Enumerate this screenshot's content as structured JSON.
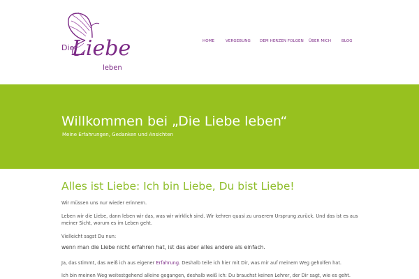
{
  "logo": {
    "word_die": "Die",
    "word_liebe": "Liebe",
    "word_leben": "leben",
    "icon": "butterfly-icon",
    "color": "#7c2a86"
  },
  "nav": {
    "items": [
      {
        "label": "HOME"
      },
      {
        "label": "VERGEBUNG"
      },
      {
        "label": "DEM HERZEN FOLGEN"
      },
      {
        "label": "ÜBER MICH"
      },
      {
        "label": "BLOG"
      }
    ],
    "color": "#7c2a86"
  },
  "hero": {
    "title": "Willkommen bei „Die Liebe leben“",
    "subtitle": "Meine Erfahrungen, Gedanken und Ansichten",
    "background": "#97c11f"
  },
  "content": {
    "title": "Alles ist Liebe: Ich bin Liebe, Du bist Liebe!",
    "p1": "Wir müssen uns nur wieder erinnern.",
    "p2": "Leben wir die Liebe, dann leben wir das, was wir wirklich sind. Wir kehren quasi zu unserem Ursprung zurück. Und das ist es aus meiner Sicht, worum es im Leben geht.",
    "p3": "Vielleicht sagst Du nun:",
    "p4": "wenn man die Liebe nicht erfahren hat, ist das aber alles andere als einfach.",
    "p5_before": "Ja, das stimmt, das weiß ich aus eigener ",
    "p5_link": "Erfahrung",
    "p5_after": ". Deshalb teile ich hier mit Dir, was mir auf meinem Weg geholfen hat.",
    "p6": "Ich bin meinen Weg weitestgehend alleine gegangen, deshalb weiß ich: Du brauchst keinen Lehrer, der Dir sagt, wie es geht.",
    "title_color": "#8fbe2c"
  }
}
